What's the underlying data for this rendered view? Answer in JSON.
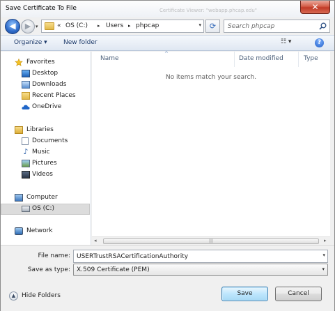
{
  "window": {
    "title": "Save Certificate To File",
    "close_glyph": "✕"
  },
  "ghost": {
    "text": "Certificate Viewer: \"webapp.phcap.edu\""
  },
  "navbar": {
    "back_glyph": "◀",
    "forward_glyph": "▶",
    "history_glyph": "▾",
    "breadcrumbs": [
      "«",
      "OS (C:)",
      "▸",
      "Users",
      "▸",
      "phpcap"
    ],
    "address_dropdown_glyph": "▾",
    "refresh_glyph": "⟳",
    "search_placeholder": "Search phpcap"
  },
  "toolbar": {
    "organize_label": "Organize ▾",
    "new_folder_label": "New folder",
    "views_label": "☷ ▾",
    "help_glyph": "?"
  },
  "sidebar": {
    "favorites": {
      "label": "Favorites",
      "items": [
        "Desktop",
        "Downloads",
        "Recent Places",
        "OneDrive"
      ]
    },
    "libraries": {
      "label": "Libraries",
      "items": [
        "Documents",
        "Music",
        "Pictures",
        "Videos"
      ]
    },
    "computer": {
      "label": "Computer",
      "items": [
        "OS (C:)"
      ]
    },
    "network": {
      "label": "Network"
    }
  },
  "filelist": {
    "columns": [
      "Name",
      "Date modified",
      "Type"
    ],
    "sort_glyph": "^",
    "empty_message": "No items match your search."
  },
  "hscroll": {
    "left_glyph": "◂",
    "right_glyph": "▸",
    "grip": "|||"
  },
  "form": {
    "file_name_label": "File name:",
    "file_name_value": "USERTrustRSACertificationAuthority",
    "save_as_type_label": "Save as type:",
    "save_as_type_value": "X.509 Certificate (PEM)",
    "dropdown_glyph": "▾"
  },
  "footer": {
    "hide_folders_label": "Hide Folders",
    "hide_folders_glyph": "▲",
    "save_label": "Save",
    "cancel_label": "Cancel"
  },
  "colors": {
    "accent": "#3c7fb1",
    "toolbar_text": "#1e3b6b",
    "selected_bg": "#dcdcdc"
  }
}
